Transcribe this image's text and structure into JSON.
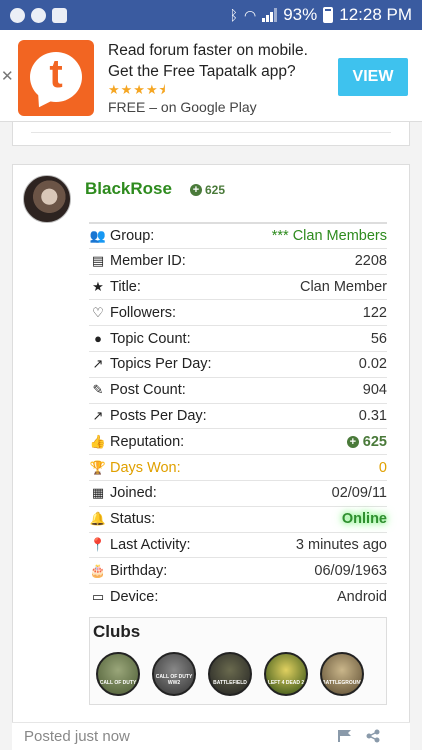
{
  "statusbar": {
    "battery": "93%",
    "time": "12:28 PM"
  },
  "ad": {
    "line1": "Read forum faster on mobile.",
    "line2": "Get the Free Tapatalk app?",
    "stars": "★★★★⯨",
    "line3": "FREE – on Google Play",
    "button": "VIEW",
    "logo_letter": "t",
    "brand_color": "#f26522",
    "button_color": "#3ec2ee"
  },
  "post": {
    "author": "BlackRose",
    "author_reputation": "625",
    "info": [
      {
        "icon": "group-icon",
        "label": "Group:",
        "value": "*** Clan Members"
      },
      {
        "icon": "id-card-icon",
        "label": "Member ID:",
        "value": "2208"
      },
      {
        "icon": "star-icon",
        "label": "Title:",
        "value": "Clan Member"
      },
      {
        "icon": "heart-icon",
        "label": "Followers:",
        "value": "122"
      },
      {
        "icon": "comments-icon",
        "label": "Topic Count:",
        "value": "56"
      },
      {
        "icon": "chart-icon",
        "label": "Topics Per Day:",
        "value": "0.02"
      },
      {
        "icon": "edit-icon",
        "label": "Post Count:",
        "value": "904"
      },
      {
        "icon": "chart-icon",
        "label": "Posts Per Day:",
        "value": "0.31"
      },
      {
        "icon": "thumbs-up-icon",
        "label": "Reputation:",
        "value": "625"
      },
      {
        "icon": "trophy-icon",
        "label": "Days Won:",
        "value": "0"
      },
      {
        "icon": "calendar-icon",
        "label": "Joined:",
        "value": "02/09/11"
      },
      {
        "icon": "bell-icon",
        "label": "Status:",
        "value": "Online"
      },
      {
        "icon": "map-marker-icon",
        "label": "Last Activity:",
        "value": "3 minutes ago"
      },
      {
        "icon": "cake-icon",
        "label": "Birthday:",
        "value": "06/09/1963"
      },
      {
        "icon": "laptop-icon",
        "label": "Device:",
        "value": "Android"
      }
    ],
    "clubs_title": "Clubs",
    "clubs": [
      {
        "name": "CALL OF DUTY",
        "color": "#6b7a52"
      },
      {
        "name": "CALL OF DUTY WW2",
        "color": "#4a4a4a"
      },
      {
        "name": "BATTLEFIELD",
        "color": "#3a3a2e"
      },
      {
        "name": "LEFT 4 DEAD 2",
        "color": "#3a5a1e"
      },
      {
        "name": "BATTLEGROUNDS",
        "color": "#8a7a5a"
      }
    ],
    "posted": "Posted just now"
  },
  "colors": {
    "accent_green": "#2e8b1e",
    "status_bar": "#3a5ba0",
    "gold": "#e0a000"
  }
}
